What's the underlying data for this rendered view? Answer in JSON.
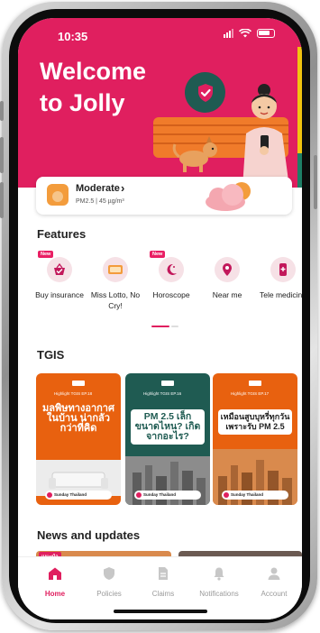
{
  "status_bar": {
    "time": "10:35",
    "battery_level": "4"
  },
  "hero": {
    "title_line1": "Welcome",
    "title_line2": "to Jolly",
    "background_color": "#e01f5f",
    "carousel_count": 3,
    "carousel_active": 2
  },
  "air_quality": {
    "status": "Moderate",
    "detail": "PM2.5 | 45 µg/m³"
  },
  "features": {
    "title": "Features",
    "items": [
      {
        "label": "Buy insurance",
        "icon": "basket-check-icon",
        "badge": "New"
      },
      {
        "label": "Miss Lotto, No Cry!",
        "icon": "lotto-ticket-icon",
        "badge": ""
      },
      {
        "label": "Horoscope",
        "icon": "crescent-moon-icon",
        "badge": "New"
      },
      {
        "label": "Near me",
        "icon": "map-pin-icon",
        "badge": ""
      },
      {
        "label": "Tele medicine",
        "icon": "telemedicine-phone-icon",
        "badge": ""
      }
    ]
  },
  "tgis": {
    "title": "TGIS",
    "cards": [
      {
        "tag": "Highlight TGIS EP.18",
        "headline": "มลพิษทางอากาศ ในบ้าน น่ากลัวกว่าที่คิด",
        "footer": "Sunday Thailand"
      },
      {
        "tag": "Highlight TGIS EP.16",
        "headline": "PM 2.5 เล็กขนาดไหน? เกิดจากอะไร?",
        "footer": "Sunday Thailand"
      },
      {
        "tag": "Highlight TGIS EP.17",
        "headline": "เหมือนสูบบุหรี่ทุกวัน เพราะรับ PM 2.5",
        "footer": "Sunday Thailand"
      }
    ]
  },
  "news": {
    "title": "News and updates",
    "first_badge": "แนะนำ"
  },
  "bottom_nav": {
    "items": [
      {
        "label": "Home",
        "icon": "home-icon",
        "active": true
      },
      {
        "label": "Policies",
        "icon": "shield-icon",
        "active": false
      },
      {
        "label": "Claims",
        "icon": "document-icon",
        "active": false
      },
      {
        "label": "Notifications",
        "icon": "bell-icon",
        "active": false
      },
      {
        "label": "Account",
        "icon": "person-icon",
        "active": false
      }
    ]
  },
  "colors": {
    "brand": "#e01f5f",
    "accent_orange": "#f07b2a",
    "card_orange": "#e8610f",
    "card_green": "#1f5b52"
  }
}
